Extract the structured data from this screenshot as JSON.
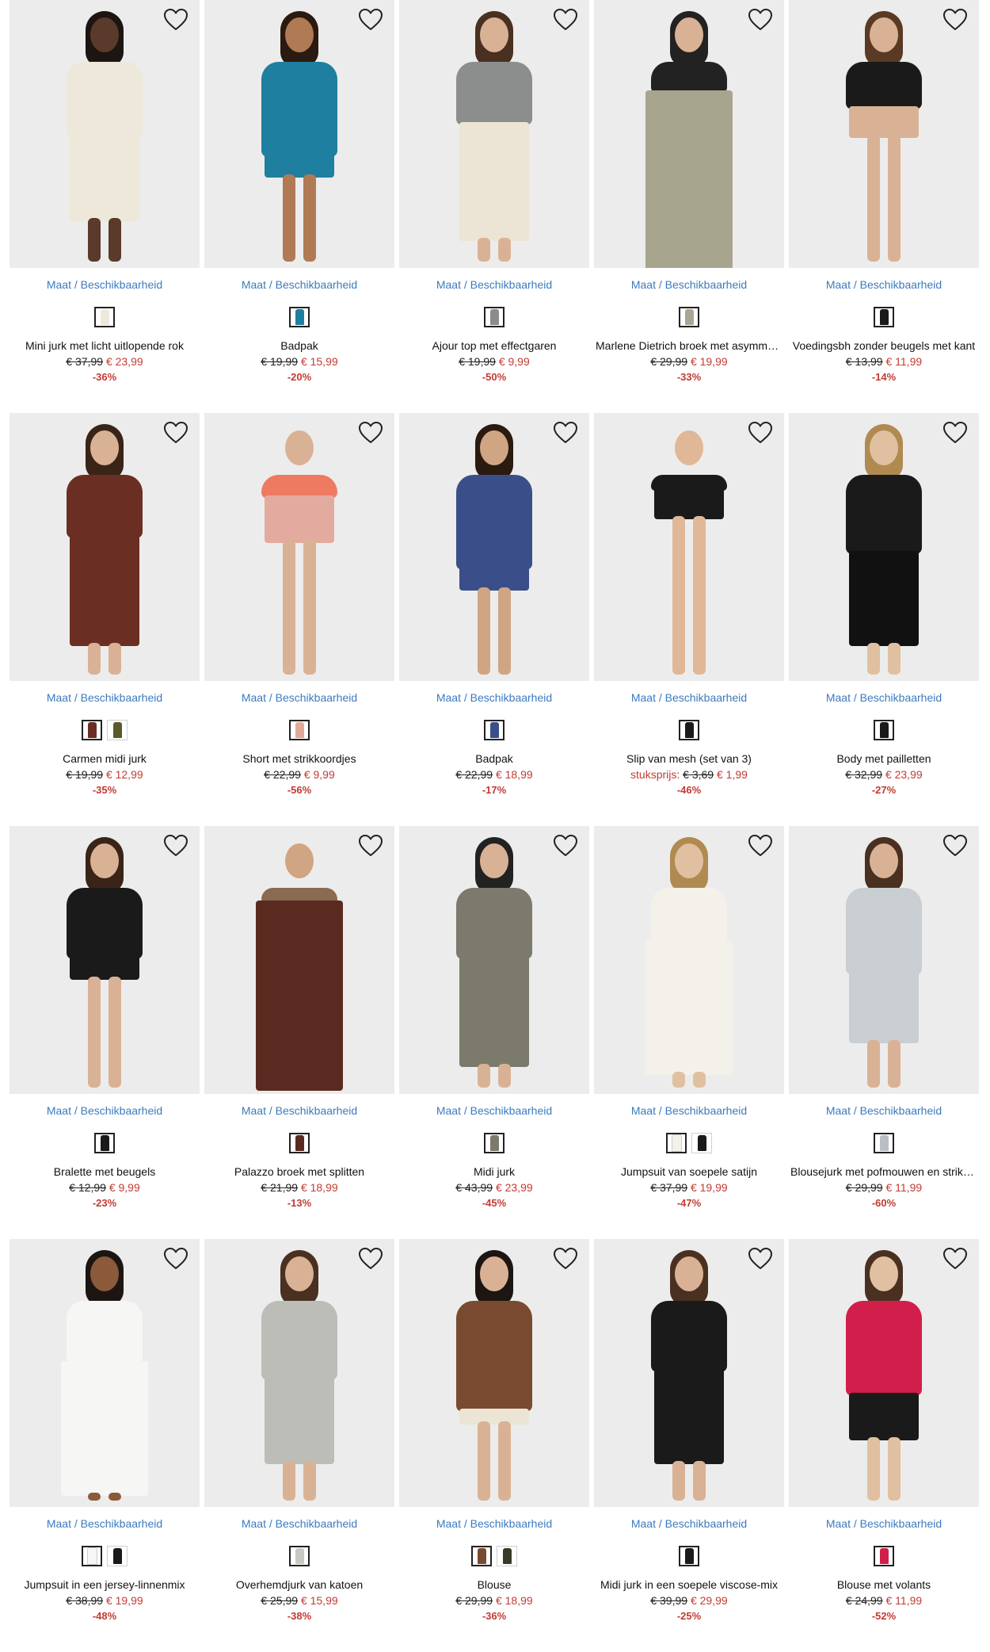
{
  "availability_label": "Maat / Beschikbaarheid",
  "colors": {
    "price_sale": "#c23b33",
    "availability_link": "#3b7bbf",
    "photo_bg": "#ececec"
  },
  "favorite_icon": "heart-outline-icon",
  "products": [
    {
      "name": "Mini jurk met licht uitlopende rok",
      "old_price": "€ 37,99",
      "price": "€ 23,99",
      "discount": "-36%",
      "colors": [
        "#efe9dc"
      ],
      "photo": {
        "top": "#eee8da",
        "bottom": "#eee8da",
        "skin": "#5a3a2a",
        "hair": "#1c1512",
        "bottomLen": 110,
        "topLen": 95
      }
    },
    {
      "name": "Badpak",
      "old_price": "€ 19,99",
      "price": "€ 15,99",
      "discount": "-20%",
      "colors": [
        "#1f7fa0"
      ],
      "photo": {
        "top": "#1f7fa0",
        "bottom": "#1f7fa0",
        "skin": "#b07a55",
        "hair": "#2a1a10",
        "bottomLen": 30,
        "topLen": 120
      }
    },
    {
      "name": "Ajour top met effectgaren",
      "old_price": "€ 19,99",
      "price": "€ 9,99",
      "discount": "-50%",
      "colors": [
        "#8a8c8c"
      ],
      "photo": {
        "top": "#8c8e8e",
        "bottom": "#ece4d4",
        "skin": "#d9b295",
        "hair": "#4a3020",
        "bottomLen": 150,
        "topLen": 80
      }
    },
    {
      "name": "Marlene Dietrich broek met asymmetrische sluiting",
      "old_price": "€ 29,99",
      "price": "€ 19,99",
      "discount": "-33%",
      "colors": [
        "#a9a792"
      ],
      "photo": {
        "top": "#222222",
        "bottom": "#a8a58f",
        "skin": "#d9b295",
        "hair": "#222222",
        "bottomLen": 240,
        "topLen": 40
      }
    },
    {
      "name": "Voedingsbh zonder beugels met kant",
      "old_price": "€ 13,99",
      "price": "€ 11,99",
      "discount": "-14%",
      "colors": [
        "#1a1a1a"
      ],
      "photo": {
        "top": "#1a1a1a",
        "bottom": "#d9b295",
        "skin": "#d9b295",
        "hair": "#5a3a24",
        "bottomLen": 40,
        "topLen": 60
      }
    },
    {
      "name": "Carmen midi jurk",
      "old_price": "€ 19,99",
      "price": "€ 12,99",
      "discount": "-35%",
      "colors": [
        "#6b2e22",
        "#5b5a2a"
      ],
      "photo": {
        "top": "#6b2e22",
        "bottom": "#6b2e22",
        "skin": "#d9b295",
        "hair": "#3a2418",
        "bottomLen": 140,
        "topLen": 80
      }
    },
    {
      "name": "Short met strikkoordjes",
      "old_price": "€ 22,99",
      "price": "€ 9,99",
      "discount": "-56%",
      "colors": [
        "#e2a99a"
      ],
      "photo": {
        "top": "#ee7a62",
        "bottom": "#e3aba0",
        "skin": "#d9b295",
        "hair": "#ececec",
        "bottomLen": 60,
        "topLen": 30
      }
    },
    {
      "name": "Badpak",
      "old_price": "€ 22,99",
      "price": "€ 18,99",
      "discount": "-17%",
      "colors": [
        "#3a4f8a"
      ],
      "photo": {
        "top": "#3a4f8a",
        "bottom": "#3a4f8a",
        "skin": "#d0a583",
        "hair": "#2a1a10",
        "bottomLen": 30,
        "topLen": 120
      }
    },
    {
      "name": "Slip van mesh (set van 3)",
      "old_price": "€ 3,69",
      "price": "€ 1,99",
      "price_prefix": "stuksprijs:",
      "discount": "-46%",
      "colors": [
        "#1a1a1a"
      ],
      "photo": {
        "top": "#1a1a1a",
        "bottom": "#1a1a1a",
        "skin": "#e0b898",
        "hair": "#ececec",
        "bottomLen": 40,
        "topLen": 20
      }
    },
    {
      "name": "Body met pailletten",
      "old_price": "€ 32,99",
      "price": "€ 23,99",
      "discount": "-27%",
      "colors": [
        "#1a1a1a"
      ],
      "photo": {
        "top": "#1a1a1a",
        "bottom": "#111111",
        "skin": "#e0c0a0",
        "hair": "#b08a50",
        "bottomLen": 120,
        "topLen": 100
      }
    },
    {
      "name": "Bralette met beugels",
      "old_price": "€ 12,99",
      "price": "€ 9,99",
      "discount": "-23%",
      "colors": [
        "#1a1a1a"
      ],
      "photo": {
        "top": "#1a1a1a",
        "bottom": "#1a1a1a",
        "skin": "#d9b295",
        "hair": "#3a2418",
        "bottomLen": 30,
        "topLen": 90
      }
    },
    {
      "name": "Palazzo broek met splitten",
      "old_price": "€ 21,99",
      "price": "€ 18,99",
      "discount": "-13%",
      "colors": [
        "#5a2a20"
      ],
      "photo": {
        "top": "#8a6a50",
        "bottom": "#5a2a20",
        "skin": "#d0a583",
        "hair": "#ececec",
        "bottomLen": 240,
        "topLen": 20
      }
    },
    {
      "name": "Midi jurk",
      "old_price": "€ 43,99",
      "price": "€ 23,99",
      "discount": "-45%",
      "colors": [
        "#7c7a6c"
      ],
      "photo": {
        "top": "#7c7a6c",
        "bottom": "#7c7a6c",
        "skin": "#d9b295",
        "hair": "#222222",
        "bottomLen": 140,
        "topLen": 90
      }
    },
    {
      "name": "Jumpsuit van soepele satijn",
      "old_price": "€ 37,99",
      "price": "€ 19,99",
      "discount": "-47%",
      "colors": [
        "#f4f1ea",
        "#1a1a1a"
      ],
      "photo": {
        "top": "#f4f1ea",
        "bottom": "#f4f1ea",
        "skin": "#e0c0a0",
        "hair": "#b08a50",
        "bottomLen": 170,
        "topLen": 70
      }
    },
    {
      "name": "Blousejurk met pofmouwen en strikceintuur",
      "old_price": "€ 29,99",
      "price": "€ 11,99",
      "discount": "-60%",
      "colors": [
        "#b8bec4"
      ],
      "photo": {
        "top": "#c9ced3",
        "bottom": "#c9ced3",
        "skin": "#d9b295",
        "hair": "#4a3020",
        "bottomLen": 90,
        "topLen": 110
      }
    },
    {
      "name": "Jumpsuit in een jersey-linnenmix",
      "old_price": "€ 38,99",
      "price": "€ 19,99",
      "discount": "-48%",
      "colors": [
        "#f6f6f4",
        "#1a1a1a"
      ],
      "photo": {
        "top": "#f6f6f4",
        "bottom": "#f6f6f4",
        "skin": "#8a5a3a",
        "hair": "#1c1512",
        "bottomLen": 170,
        "topLen": 80
      }
    },
    {
      "name": "Overhemdjurk van katoen",
      "old_price": "€ 25,99",
      "price": "€ 15,99",
      "discount": "-38%",
      "colors": [
        "#c8c8c4"
      ],
      "photo": {
        "top": "#bdbdb8",
        "bottom": "#bdbdb8",
        "skin": "#d9b295",
        "hair": "#4a3020",
        "bottomLen": 110,
        "topLen": 100
      }
    },
    {
      "name": "Blouse",
      "old_price": "€ 29,99",
      "price": "€ 18,99",
      "discount": "-36%",
      "colors": [
        "#7a4a30",
        "#3a3a2a"
      ],
      "photo": {
        "top": "#7a4a30",
        "bottom": "#ece4d4",
        "skin": "#d9b295",
        "hair": "#1c1512",
        "bottomLen": 20,
        "topLen": 140
      }
    },
    {
      "name": "Midi jurk in een soepele viscose-mix",
      "old_price": "€ 39,99",
      "price": "€ 29,99",
      "discount": "-25%",
      "colors": [
        "#1a1a1a"
      ],
      "photo": {
        "top": "#1a1a1a",
        "bottom": "#1a1a1a",
        "skin": "#d9b295",
        "hair": "#4a3020",
        "bottomLen": 120,
        "topLen": 90
      }
    },
    {
      "name": "Blouse met volants",
      "old_price": "€ 24,99",
      "price": "€ 11,99",
      "discount": "-52%",
      "colors": [
        "#d21e4a"
      ],
      "photo": {
        "top": "#d21e4a",
        "bottom": "#1a1a1a",
        "skin": "#e0c0a0",
        "hair": "#4a3020",
        "bottomLen": 60,
        "topLen": 120
      }
    }
  ]
}
